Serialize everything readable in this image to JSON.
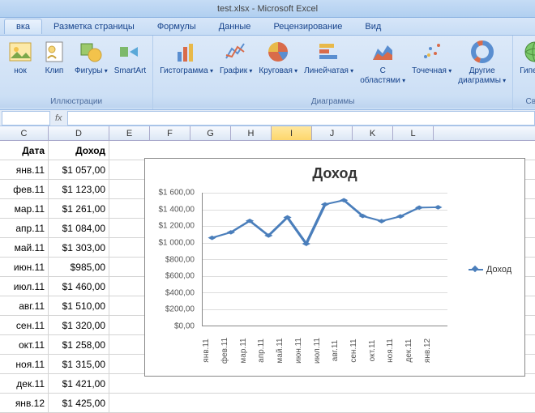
{
  "title": "test.xlsx - Microsoft Excel",
  "tabs": {
    "t0": "вка",
    "t1": "Разметка страницы",
    "t2": "Формулы",
    "t3": "Данные",
    "t4": "Рецензирование",
    "t5": "Вид"
  },
  "ribbon": {
    "illustrations": {
      "label": "Иллюстрации",
      "picture": "нок",
      "clip": "Клип",
      "shapes": "Фигуры",
      "smartart": "SmartArt"
    },
    "charts": {
      "label": "Диаграммы",
      "column": "Гистограмма",
      "line": "График",
      "pie": "Круговая",
      "bar": "Линейчатая",
      "area": "С\nобластями",
      "scatter": "Точечная",
      "other": "Другие\nдиаграммы"
    },
    "links": {
      "label": "Связ",
      "hyperlink": "Гиперсс"
    }
  },
  "columns": [
    "C",
    "D",
    "E",
    "F",
    "G",
    "H",
    "I",
    "J",
    "K",
    "L"
  ],
  "selected_col": "I",
  "table": {
    "h1": "Дата",
    "h2": "Доход",
    "rows": [
      {
        "date": "янв.11",
        "val": "$1 057,00"
      },
      {
        "date": "фев.11",
        "val": "$1 123,00"
      },
      {
        "date": "мар.11",
        "val": "$1 261,00"
      },
      {
        "date": "апр.11",
        "val": "$1 084,00"
      },
      {
        "date": "май.11",
        "val": "$1 303,00"
      },
      {
        "date": "июн.11",
        "val": "$985,00"
      },
      {
        "date": "июл.11",
        "val": "$1 460,00"
      },
      {
        "date": "авг.11",
        "val": "$1 510,00"
      },
      {
        "date": "сен.11",
        "val": "$1 320,00"
      },
      {
        "date": "окт.11",
        "val": "$1 258,00"
      },
      {
        "date": "ноя.11",
        "val": "$1 315,00"
      },
      {
        "date": "дек.11",
        "val": "$1 421,00"
      },
      {
        "date": "янв.12",
        "val": "$1 425,00"
      }
    ]
  },
  "chart_data": {
    "type": "line",
    "title": "Доход",
    "legend": "Доход",
    "ylim": [
      0,
      1600
    ],
    "ytick_step": 200,
    "y_ticks": [
      "$0,00",
      "$200,00",
      "$400,00",
      "$600,00",
      "$800,00",
      "$1 000,00",
      "$1 200,00",
      "$1 400,00",
      "$1 600,00"
    ],
    "categories": [
      "янв.11",
      "фев.11",
      "мар.11",
      "апр.11",
      "май.11",
      "июн.11",
      "июл.11",
      "авг.11",
      "сен.11",
      "окт.11",
      "ноя.11",
      "дек.11",
      "янв.12"
    ],
    "series": [
      {
        "name": "Доход",
        "values": [
          1057,
          1123,
          1261,
          1084,
          1303,
          985,
          1460,
          1510,
          1320,
          1258,
          1315,
          1421,
          1425
        ],
        "color": "#4a7ebb"
      }
    ]
  }
}
